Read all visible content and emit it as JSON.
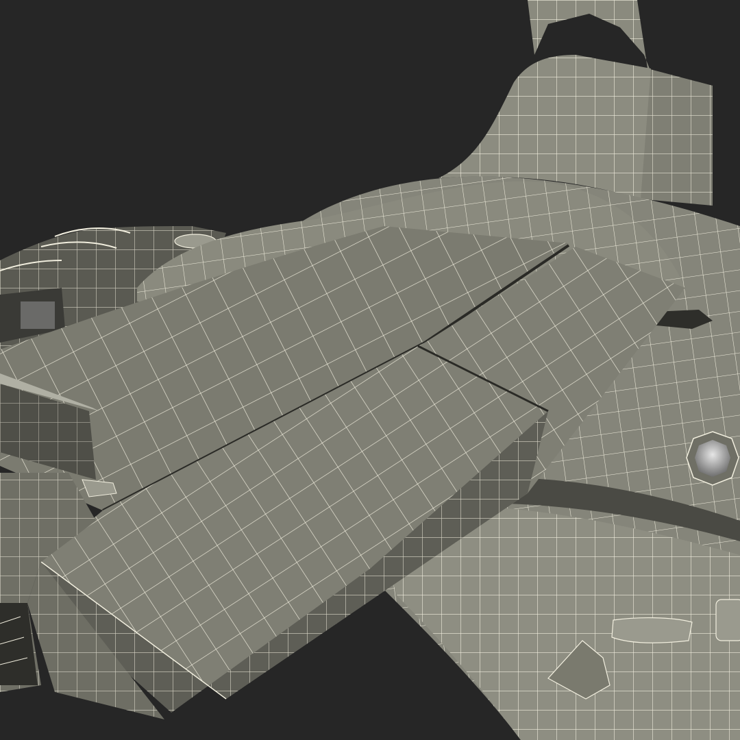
{
  "scene": {
    "subject": "wireframe-aircraft-render",
    "colors": {
      "background": "#262626",
      "surface_light": "#8c8c80",
      "surface_mid": "#7a7a6e",
      "surface_dark": "#5f5f56",
      "surface_shadow": "#3d3d38",
      "wire": "#f2efdf",
      "metal_light": "#d8d8d8",
      "metal_dark": "#6e6e6e"
    }
  }
}
